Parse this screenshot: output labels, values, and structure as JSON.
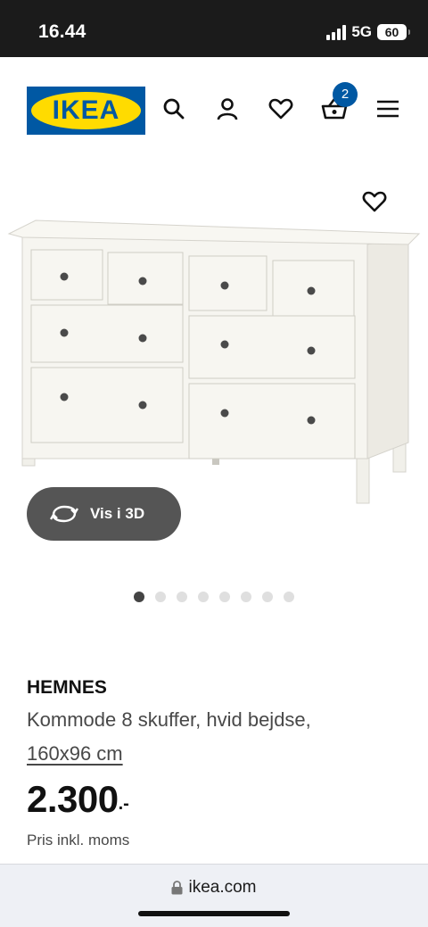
{
  "status_bar": {
    "time": "16.44",
    "network": "5G",
    "battery": "60"
  },
  "header": {
    "logo_text": "IKEA",
    "cart_count": "2",
    "icons": [
      "search-icon",
      "account-icon",
      "heart-icon",
      "basket-icon",
      "menu-icon"
    ]
  },
  "gallery": {
    "view3d_label": "Vis i 3D",
    "image_count": 8,
    "active_index": 0
  },
  "product": {
    "name": "HEMNES",
    "description": "Kommode 8 skuffer, hvid bejdse,",
    "size": "160x96 cm",
    "price": "2.300",
    "price_suffix": ".-",
    "price_note": "Pris inkl. moms"
  },
  "browser": {
    "url": "ikea.com"
  },
  "colors": {
    "brand_blue": "#0058a3",
    "brand_yellow": "#ffdb00",
    "button_gray": "#555555"
  }
}
